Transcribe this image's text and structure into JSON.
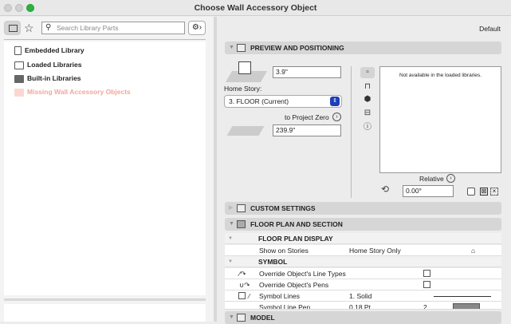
{
  "window": {
    "title": "Choose Wall Accessory Object"
  },
  "search": {
    "placeholder": "Search Library Parts"
  },
  "library": {
    "items": [
      "Embedded Library",
      "Loaded Libraries",
      "Built-in Libraries",
      "Missing Wall Accessory Objects"
    ]
  },
  "right": {
    "default_label": "Default"
  },
  "preview": {
    "header": "PREVIEW AND POSITIONING",
    "height_value": "3.9\"",
    "home_story_label": "Home Story:",
    "home_story_value": "3. FLOOR (Current)",
    "project_zero_label": "to Project Zero",
    "elevation_value": "239.9\"",
    "preview_message": "Not available in the loaded libraries.",
    "relative_label": "Relative",
    "angle_value": "0.00°"
  },
  "sections": {
    "custom": "CUSTOM SETTINGS",
    "floor_plan": "FLOOR PLAN AND SECTION",
    "model": "MODEL"
  },
  "table": {
    "fpd": "FLOOR PLAN DISPLAY",
    "show_on_stories": {
      "label": "Show on Stories",
      "value": "Home Story Only"
    },
    "symbol": "SYMBOL",
    "override_line_types": "Override Object's Line Types",
    "override_pens": "Override Object's Pens",
    "symbol_lines": {
      "label": "Symbol Lines",
      "value": "1. Solid"
    },
    "symbol_line_pen": {
      "label": "Symbol Line Pen",
      "value": "0.18 Pt",
      "pen": "2"
    }
  }
}
